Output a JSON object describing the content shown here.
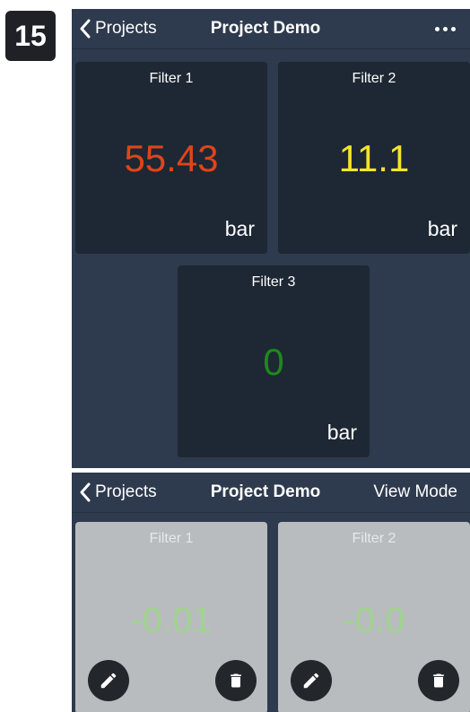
{
  "step": "15",
  "colors": {
    "screen_bg": "#2e3a4d",
    "tile_bg": "#1e2734",
    "tile_light_bg": "#b9bcbf",
    "value_red": "#e04418",
    "value_yellow": "#f2e52a",
    "value_green": "#1c8a1c",
    "value_light_green": "#9fd48e"
  },
  "top_screen": {
    "nav": {
      "back_label": "Projects",
      "title": "Project Demo"
    },
    "tiles": [
      {
        "label": "Filter 1",
        "value": "55.43",
        "unit": "bar",
        "color": "#e04418"
      },
      {
        "label": "Filter 2",
        "value": "11.1",
        "unit": "bar",
        "color": "#f2e52a"
      },
      {
        "label": "Filter 3",
        "value": "0",
        "unit": "bar",
        "color": "#1c8a1c"
      }
    ]
  },
  "bottom_screen": {
    "nav": {
      "back_label": "Projects",
      "title": "Project Demo",
      "mode_label": "View Mode"
    },
    "tiles": [
      {
        "label": "Filter 1",
        "value": "-0.01"
      },
      {
        "label": "Filter 2",
        "value": "-0.0"
      }
    ]
  }
}
